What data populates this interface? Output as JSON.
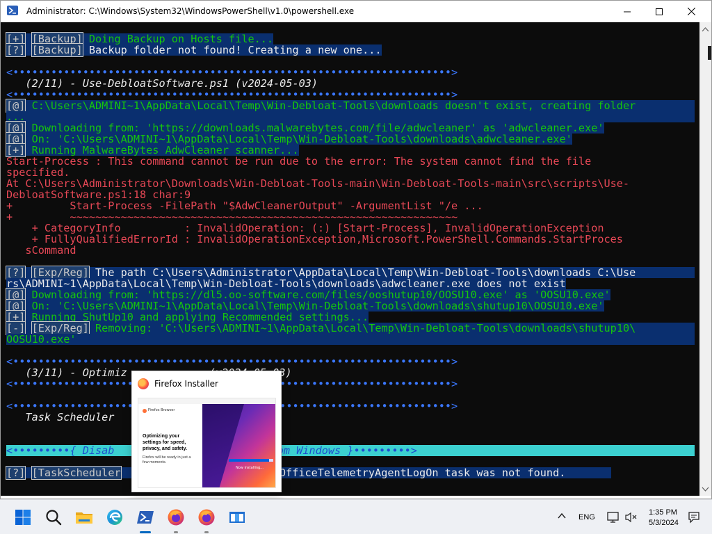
{
  "window": {
    "title": "Administrator: C:\\Windows\\System32\\WindowsPowerShell\\v1.0\\powershell.exe"
  },
  "console": {
    "l1_tag": "[+]",
    "l1_box": "[Backup]",
    "l1_text": " Doing Backup on Hosts file...",
    "l2_tag": "[?]",
    "l2_box": "[Backup]",
    "l2_text": " Backup folder not found! Creating a new one...",
    "sep1": "<•••••••••••••••••••••••••••••••••••••••••••••••••••••••••••••••••••••>",
    "step2": "   (2/11) - Use-DebloatSoftware.ps1 (v2024-05-03)",
    "sep2": "<•••••••••••••••••••••••••••••••••••••••••••••••••••••••••••••••••••••>",
    "l3_tag": "[@]",
    "l3_text": " C:\\Users\\ADMINI~1\\AppData\\Local\\Temp\\Win-Debloat-Tools\\downloads doesn't exist, creating folder",
    "l3b": "...",
    "l4_tag": "[@]",
    "l4_text": " Downloading from: 'https://downloads.malwarebytes.com/file/adwcleaner' as 'adwcleaner.exe'",
    "l5_tag": "[@]",
    "l5_text": " On: 'C:\\Users\\ADMINI~1\\AppData\\Local\\Temp\\Win-Debloat-Tools\\downloads\\adwcleaner.exe'",
    "l6_tag": "[+]",
    "l6_text": " Running MalwareBytes AdwCleaner scanner...",
    "err1": "Start-Process : This command cannot be run due to the error: The system cannot find the file",
    "err2": "specified.",
    "err3": "At C:\\Users\\Administrator\\Downloads\\Win-Debloat-Tools-main\\Win-Debloat-Tools-main\\src\\scripts\\Use-",
    "err4": "DebloatSoftware.ps1:18 char:9",
    "err5": "+         Start-Process -FilePath \"$AdwCleanerOutput\" -ArgumentList \"/e ...",
    "err6": "+         ~~~~~~~~~~~~~~~~~~~~~~~~~~~~~~~~~~~~~~~~~~~~~~~~~~~~~~~~~~~~~",
    "err7": "    + CategoryInfo          : InvalidOperation: (:) [Start-Process], InvalidOperationException",
    "err8": "    + FullyQualifiedErrorId : InvalidOperationException,Microsoft.PowerShell.Commands.StartProces",
    "err9": "   sCommand",
    "l7_tag": "[?]",
    "l7_box": "[Exp/Reg]",
    "l7_text": " The path C:\\Users\\Administrator\\AppData\\Local\\Temp\\Win-Debloat-Tools\\downloads C:\\Use",
    "l7b": "rs\\ADMINI~1\\AppData\\Local\\Temp\\Win-Debloat-Tools\\downloads\\adwcleaner.exe does not exist",
    "l8_tag": "[@]",
    "l8_text": " Downloading from: 'https://dl5.oo-software.com/files/ooshutup10/OOSU10.exe' as 'OOSU10.exe'",
    "l9_tag": "[@]",
    "l9_text": " On: 'C:\\Users\\ADMINI~1\\AppData\\Local\\Temp\\Win-Debloat-Tools\\downloads\\shutup10\\OOSU10.exe'",
    "l10_tag": "[+]",
    "l10_text": " Running ShutUp10 and applying Recommended settings...",
    "l11_tag": "[-]",
    "l11_box": "[Exp/Reg]",
    "l11_text": " Removing: 'C:\\Users\\ADMINI~1\\AppData\\Local\\Temp\\Win-Debloat-Tools\\downloads\\shutup10\\",
    "l11b": "OOSU10.exe'",
    "sep3": "<•••••••••••••••••••••••••••••••••••••••••••••••••••••••••••••••••••••>",
    "step3a": "   (3/11) - Optimiz",
    "step3b": "(v2024-05-03)",
    "sep4": "<•••••••••••••••••••••••••••••••••••••••••••••••••••••••••••••••••••••>",
    "sep5": "<•••••••••••••••••••••••••••••••••••••••••••••••••••••••••••••••••••••>",
    "sched": "   Task Scheduler",
    "bar_dots_l": "<•••••••••",
    "bar_text_l": "{ Disab",
    "bar_text_r": "From Windows }",
    "bar_dots_r": "•••••••••>",
    "l12_tag": "[?]",
    "l12_box": "[TaskScheduler",
    "l12_text": "e\\OfficeTelemetryAgentLogOn task was not found."
  },
  "popup": {
    "title": "Firefox Installer",
    "brand": "Firefox Browser",
    "heading": "Optimizing your settings for speed, privacy, and safety.",
    "sub": "Firefox will be ready in just a few moments.",
    "installing": "Now installing...",
    "progress": 0.9
  },
  "taskbar": {
    "icons": [
      "start-icon",
      "search-icon",
      "file-explorer-icon",
      "edge-icon",
      "powershell-icon",
      "firefox-icon",
      "firefox-installer-icon",
      "window-icon"
    ],
    "lang": "ENG",
    "time": "1:35 PM",
    "date": "5/3/2024"
  },
  "colors": {
    "console_bg": "#0c0c0c",
    "green": "#16c60c",
    "red": "#e74856",
    "blue": "#3b78ff",
    "highlight": "#0a2f6f",
    "accent": "#0067c0"
  }
}
